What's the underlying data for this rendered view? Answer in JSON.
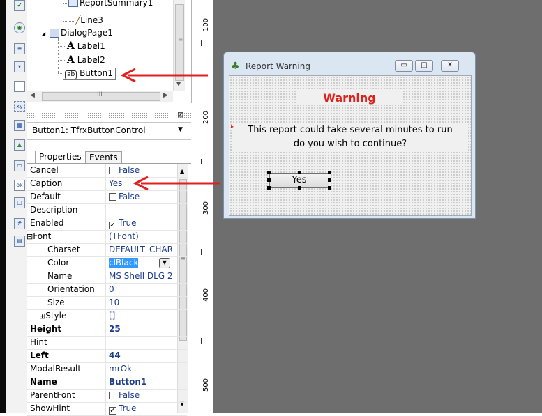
{
  "tree": {
    "items": [
      {
        "label": "ReportSummary1"
      },
      {
        "label": "Line3"
      },
      {
        "label": "DialogPage1"
      },
      {
        "label": "Label1"
      },
      {
        "label": "Label2"
      },
      {
        "label": "Button1"
      }
    ]
  },
  "combo": {
    "value": "Button1: TfrxButtonControl"
  },
  "tabs": {
    "properties": "Properties",
    "events": "Events"
  },
  "properties": [
    {
      "name": "Cancel",
      "value": "False",
      "kind": "check",
      "checked": false
    },
    {
      "name": "Caption",
      "value": "Yes"
    },
    {
      "name": "Default",
      "value": "False",
      "kind": "check",
      "checked": false
    },
    {
      "name": "Description",
      "value": ""
    },
    {
      "name": "Enabled",
      "value": "True",
      "kind": "check",
      "checked": true
    },
    {
      "name": "Font",
      "value": "(TFont)",
      "expander": "⊟"
    },
    {
      "name": "Charset",
      "value": "DEFAULT_CHAR"
    },
    {
      "name": "Color",
      "value": "clBlack",
      "selected": true
    },
    {
      "name": "Name",
      "value": "MS Shell DLG 2"
    },
    {
      "name": "Orientation",
      "value": "0"
    },
    {
      "name": "Size",
      "value": "10"
    },
    {
      "name": "Style",
      "value": "[]",
      "expander": "⊞"
    },
    {
      "name": "Height",
      "value": "25",
      "bold": true
    },
    {
      "name": "Hint",
      "value": ""
    },
    {
      "name": "Left",
      "value": "44",
      "bold": true
    },
    {
      "name": "ModalResult",
      "value": "mrOk"
    },
    {
      "name": "Name",
      "value": "Button1",
      "bold": true
    },
    {
      "name": "ParentFont",
      "value": "False",
      "kind": "check",
      "checked": false
    },
    {
      "name": "ShowHint",
      "value": "True",
      "kind": "check",
      "checked": true
    }
  ],
  "ruler": {
    "labels": [
      "100",
      "200",
      "300",
      "400",
      "500"
    ]
  },
  "dialog": {
    "title": "Report Warning",
    "warning": "Warning",
    "message_line1": "This report could take several minutes to run",
    "message_line2": "do you wish to continue?",
    "button": "Yes"
  },
  "colors": {
    "warning": "#e0201b",
    "arrow": "#e02020",
    "canvas": "#6e6e6e"
  }
}
